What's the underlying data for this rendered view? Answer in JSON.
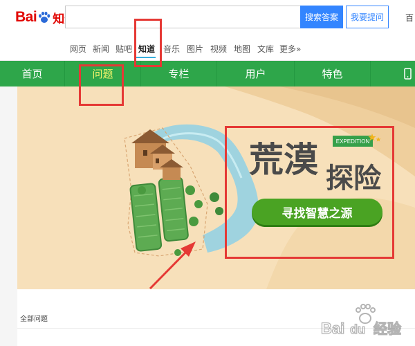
{
  "header": {
    "logo": {
      "bai": "Bai",
      "du": "du",
      "zhidao": "知道"
    },
    "search_value": "",
    "search_button": "搜索答案",
    "ask_button": "我要提问",
    "cut_text": "百"
  },
  "subnav": {
    "items": [
      "网页",
      "新闻",
      "贴吧",
      "知道",
      "音乐",
      "图片",
      "视频",
      "地图",
      "文库",
      "更多»"
    ],
    "active_index": 3
  },
  "greenbar": {
    "tabs": [
      "首页",
      "问题",
      "专栏",
      "用户",
      "特色"
    ],
    "active_index": 1
  },
  "banner": {
    "title_1": "荒漠",
    "title_2": "探险",
    "ribbon": "EXPEDITION",
    "pill_text": "寻找智慧之源"
  },
  "lower": {
    "label": "全部问题"
  },
  "watermark": {
    "text_1": "Bai",
    "text_2": "du",
    "text_3": "经验"
  },
  "colors": {
    "green": "#2ea64a",
    "active_tab": "#f0f36a",
    "search_blue": "#3385ff",
    "annotation_red": "#e53935",
    "banner_bg": "#f7e0ba"
  }
}
